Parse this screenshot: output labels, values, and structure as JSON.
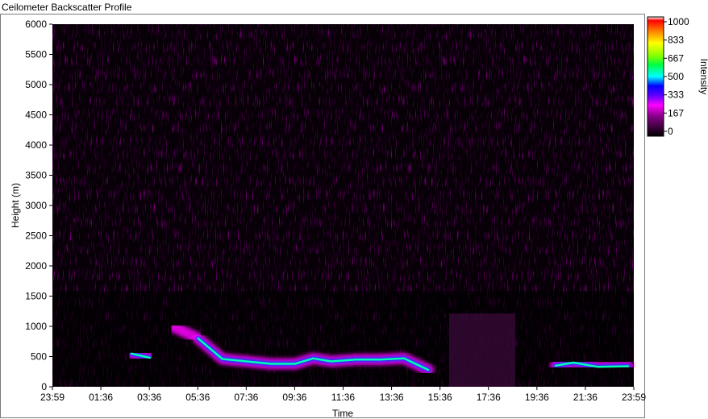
{
  "window": {
    "title": "Ceilometer Backscatter Profile"
  },
  "chart_data": {
    "type": "heatmap",
    "title": "Ceilometer Backscatter Profile",
    "xlabel": "Time",
    "ylabel": "Height (m)",
    "x_ticks": [
      "23:59",
      "01:36",
      "03:36",
      "05:36",
      "07:36",
      "09:36",
      "11:36",
      "13:36",
      "15:36",
      "17:36",
      "19:36",
      "21:36",
      "23:59"
    ],
    "y_ticks": [
      0,
      500,
      1000,
      1500,
      2000,
      2500,
      3000,
      3500,
      4000,
      4500,
      5000,
      5500,
      6000
    ],
    "ylim": [
      0,
      6000
    ],
    "colorbar": {
      "label": "Intensity",
      "range": [
        0,
        1000
      ],
      "ticks": [
        0,
        167,
        333,
        500,
        667,
        833,
        1000
      ]
    },
    "cloud_layer": {
      "time": [
        "03:15",
        "04:00",
        "05:00",
        "06:00",
        "07:00",
        "08:00",
        "09:00",
        "10:00",
        "10:45",
        "11:30",
        "12:30",
        "13:30",
        "14:30",
        "15:30",
        "20:45",
        "21:30",
        "22:30",
        "23:45"
      ],
      "base_height_m": [
        550,
        480,
        990,
        800,
        460,
        420,
        380,
        380,
        470,
        420,
        450,
        450,
        470,
        280,
        350,
        400,
        330,
        340
      ]
    },
    "grid": false,
    "legend": "none"
  }
}
